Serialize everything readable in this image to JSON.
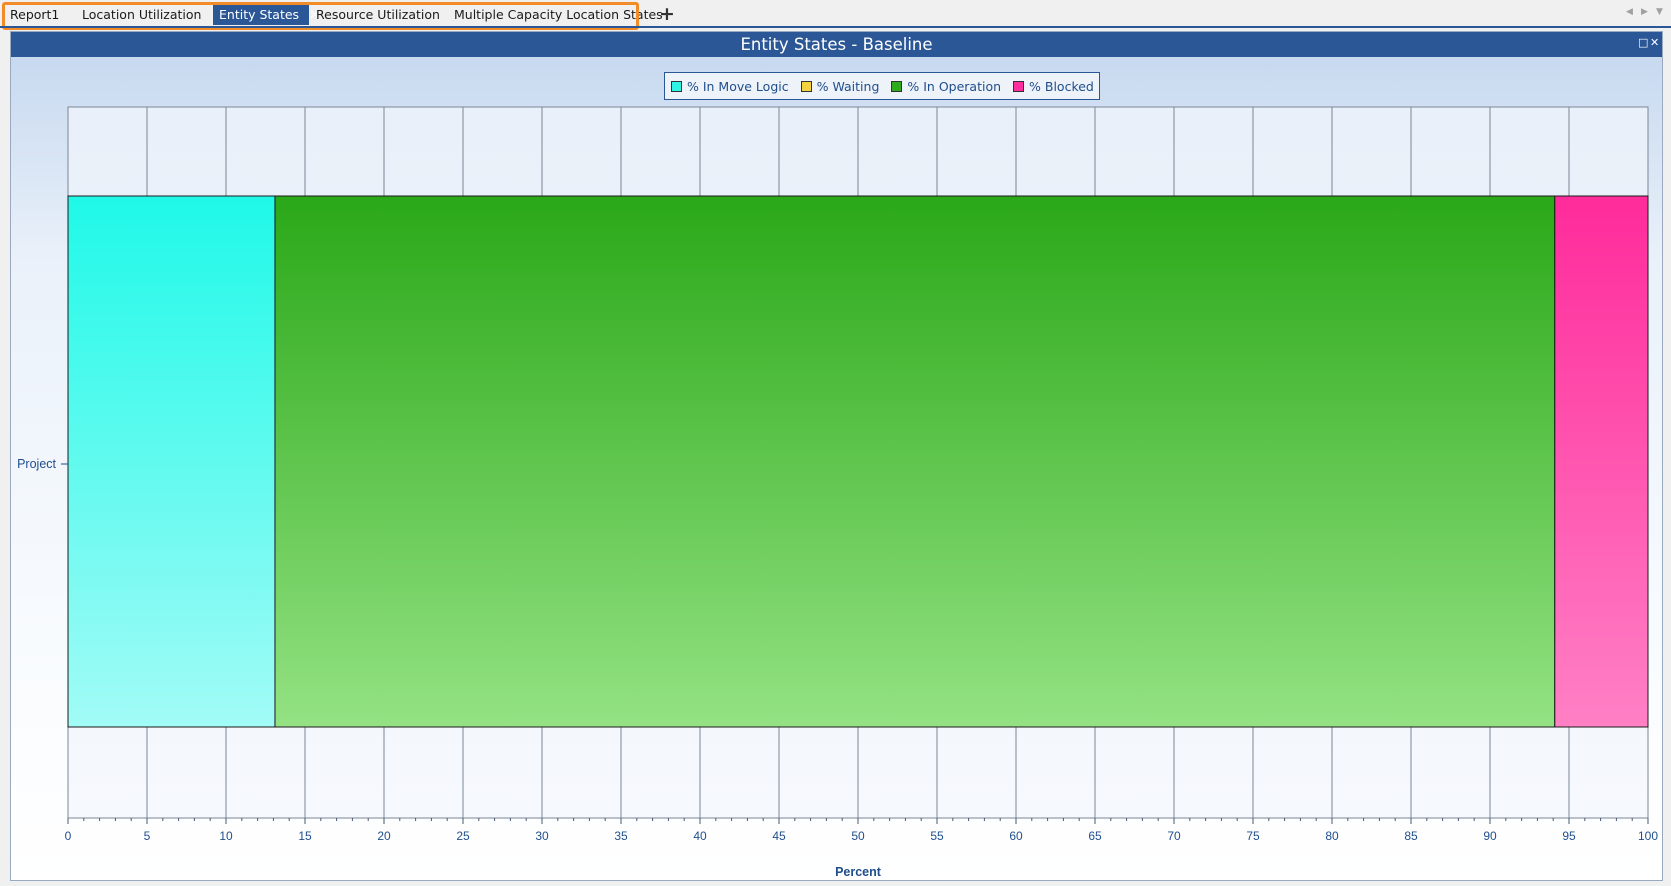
{
  "tabs": [
    {
      "label": "Report1",
      "active": false
    },
    {
      "label": "Location Utilization",
      "active": false
    },
    {
      "label": "Entity States",
      "active": true,
      "close_icon": "✕"
    },
    {
      "label": "Resource Utilization",
      "active": false
    },
    {
      "label": "Multiple Capacity Location States",
      "active": false
    }
  ],
  "add_tab_icon": "plus-icon",
  "add_tab_glyph": "+",
  "window": {
    "title": "Entity States - Baseline",
    "restore_glyph": "□",
    "close_glyph": "✕"
  },
  "colors": {
    "title_bar": "#2b5797",
    "tab_highlight": "#f28c28",
    "move_logic": "#2ef5e6",
    "waiting": "#f5d33f",
    "in_operation": "#2eab1a",
    "blocked": "#ff2e9e"
  },
  "chart_data": {
    "type": "bar",
    "orientation": "horizontal",
    "stacked": true,
    "categories": [
      "Project"
    ],
    "series": [
      {
        "name": "% In Move Logic",
        "values": [
          13.1
        ],
        "color": "#2ef5e6"
      },
      {
        "name": "% Waiting",
        "values": [
          0
        ],
        "color": "#f5d33f"
      },
      {
        "name": "% In Operation",
        "values": [
          81.0
        ],
        "color": "#2eab1a"
      },
      {
        "name": "% Blocked",
        "values": [
          5.9
        ],
        "color": "#ff2e9e"
      }
    ],
    "xlabel": "Percent",
    "ylabel": "",
    "xlim": [
      0,
      100
    ],
    "xticks": [
      0,
      5,
      10,
      15,
      20,
      25,
      30,
      35,
      40,
      45,
      50,
      55,
      60,
      65,
      70,
      75,
      80,
      85,
      90,
      95,
      100
    ],
    "grid": true,
    "legend": "top-center"
  }
}
